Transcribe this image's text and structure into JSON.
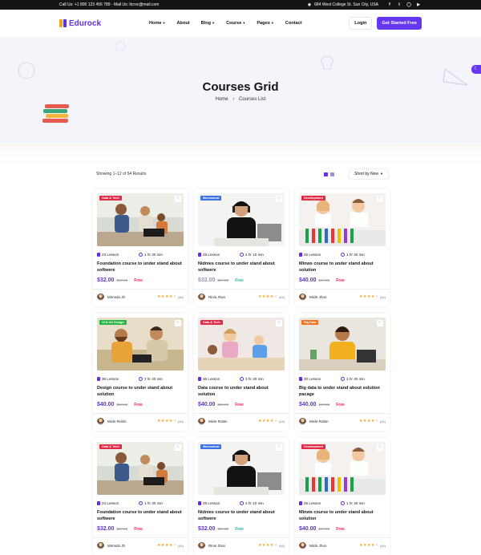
{
  "topbar": {
    "contact": "Call Us: +1 800 123 456 789 - Mail Us: ltcroc@mail.com",
    "address": "684 West College St. Sun City, USA",
    "social": [
      "facebook-icon",
      "twitter-icon",
      "instagram-icon",
      "youtube-icon"
    ]
  },
  "header": {
    "logo": "Edurock",
    "nav": [
      {
        "label": "Home",
        "dropdown": true
      },
      {
        "label": "About",
        "dropdown": false
      },
      {
        "label": "Blog",
        "dropdown": true
      },
      {
        "label": "Course",
        "dropdown": true
      },
      {
        "label": "Pages",
        "dropdown": true
      },
      {
        "label": "Contact",
        "dropdown": false
      }
    ],
    "login": "Login",
    "cta": "Get Started Free"
  },
  "hero": {
    "title": "Courses Grid",
    "crumb_home": "Home",
    "crumb_current": "Courses List"
  },
  "toolbar": {
    "results": "Showing 1–12 of 54 Results",
    "sort": "Short by New"
  },
  "colors": {
    "accent": "#5f2dee",
    "red": "#ff1949",
    "green": "#1ab69d",
    "star": "#f2a31a"
  },
  "cards": [
    {
      "badge": "Data & Tech",
      "badge_color": "#e22a47",
      "img": "family",
      "lessons": "23 Lesson",
      "time": "1 hr 30 min",
      "title": "Foundation course to under stand about softwere",
      "price": "$32.00",
      "old": "$67.00",
      "free": "Free",
      "free_color": "#ff1949",
      "author": "Mirnsdo Jh",
      "rating": 4,
      "reviews": "(44)"
    },
    {
      "badge": "Mechanical",
      "badge_color": "#3b72e3",
      "img": "boy",
      "lessons": "29 Lesson",
      "time": "2 hr 10 min",
      "title": "Nidnies course to under stand about softwere",
      "price": "$32.00",
      "old": "$67.00",
      "free": "Free",
      "free_color": "#1ab69d",
      "author": "Rinis Jhon",
      "rating": 4,
      "reviews": "(44)",
      "muted": true
    },
    {
      "badge": "Development",
      "badge_color": "#e22a47",
      "img": "lab",
      "lessons": "25 Lesson",
      "time": "1 hr 40 min",
      "title": "Minws course to under stand about solution",
      "price": "$40.00",
      "old": "$67.00",
      "free": "Free",
      "free_color": "#ff1949",
      "author": "Micle Jhon",
      "rating": 4,
      "reviews": "(44)"
    },
    {
      "badge": "UI & UX Design",
      "badge_color": "#27b643",
      "img": "couple",
      "lessons": "36 Lesson",
      "time": "3 hr 40 min",
      "title": "Design course to under stand about solution",
      "price": "$40.00",
      "old": "$67.00",
      "free": "Free",
      "free_color": "#ff1949",
      "author": "Micle Robin",
      "rating": 4,
      "reviews": "(44)"
    },
    {
      "badge": "Data & Tech",
      "badge_color": "#e22a47",
      "img": "kids",
      "lessons": "36 Lesson",
      "time": "3 hr 40 min",
      "title": "Data course to under stand about solution",
      "price": "$40.00",
      "old": "$67.00",
      "free": "Free",
      "free_color": "#ff1949",
      "author": "Micle Robin",
      "rating": 4,
      "reviews": "(44)"
    },
    {
      "badge": "Big Data",
      "badge_color": "#f2711f",
      "img": "woman",
      "lessons": "30 Lesson",
      "time": "3 hr 40 min",
      "title": "Big data to under stand about solution pacage",
      "price": "$40.00",
      "old": "$67.00",
      "free": "Free",
      "free_color": "#ff1949",
      "author": "Micle Robin",
      "rating": 4,
      "reviews": "(44)"
    },
    {
      "badge": "Data & Tech",
      "badge_color": "#e22a47",
      "img": "family",
      "lessons": "23 Lesson",
      "time": "1 hr 30 min",
      "title": "Foundation course to under stand about softwere",
      "price": "$32.00",
      "old": "$67.00",
      "free": "Free",
      "free_color": "#ff1949",
      "author": "Mirnsdo Jh",
      "rating": 4,
      "reviews": "(44)"
    },
    {
      "badge": "Mechanical",
      "badge_color": "#3b72e3",
      "img": "boy",
      "lessons": "29 Lesson",
      "time": "2 hr 10 min",
      "title": "Nidnies course to under stand about softwere",
      "price": "$32.00",
      "old": "$67.00",
      "free": "Free",
      "free_color": "#1ab69d",
      "author": "Rinis Jhon",
      "rating": 4,
      "reviews": "(44)"
    },
    {
      "badge": "Development",
      "badge_color": "#e22a47",
      "img": "lab",
      "lessons": "25 Lesson",
      "time": "1 hr 40 min",
      "title": "Minws course to under stand about solution",
      "price": "$40.00",
      "old": "$67.00",
      "free": "Free",
      "free_color": "#ff1949",
      "author": "Micle Jhon",
      "rating": 4,
      "reviews": "(44)"
    }
  ]
}
